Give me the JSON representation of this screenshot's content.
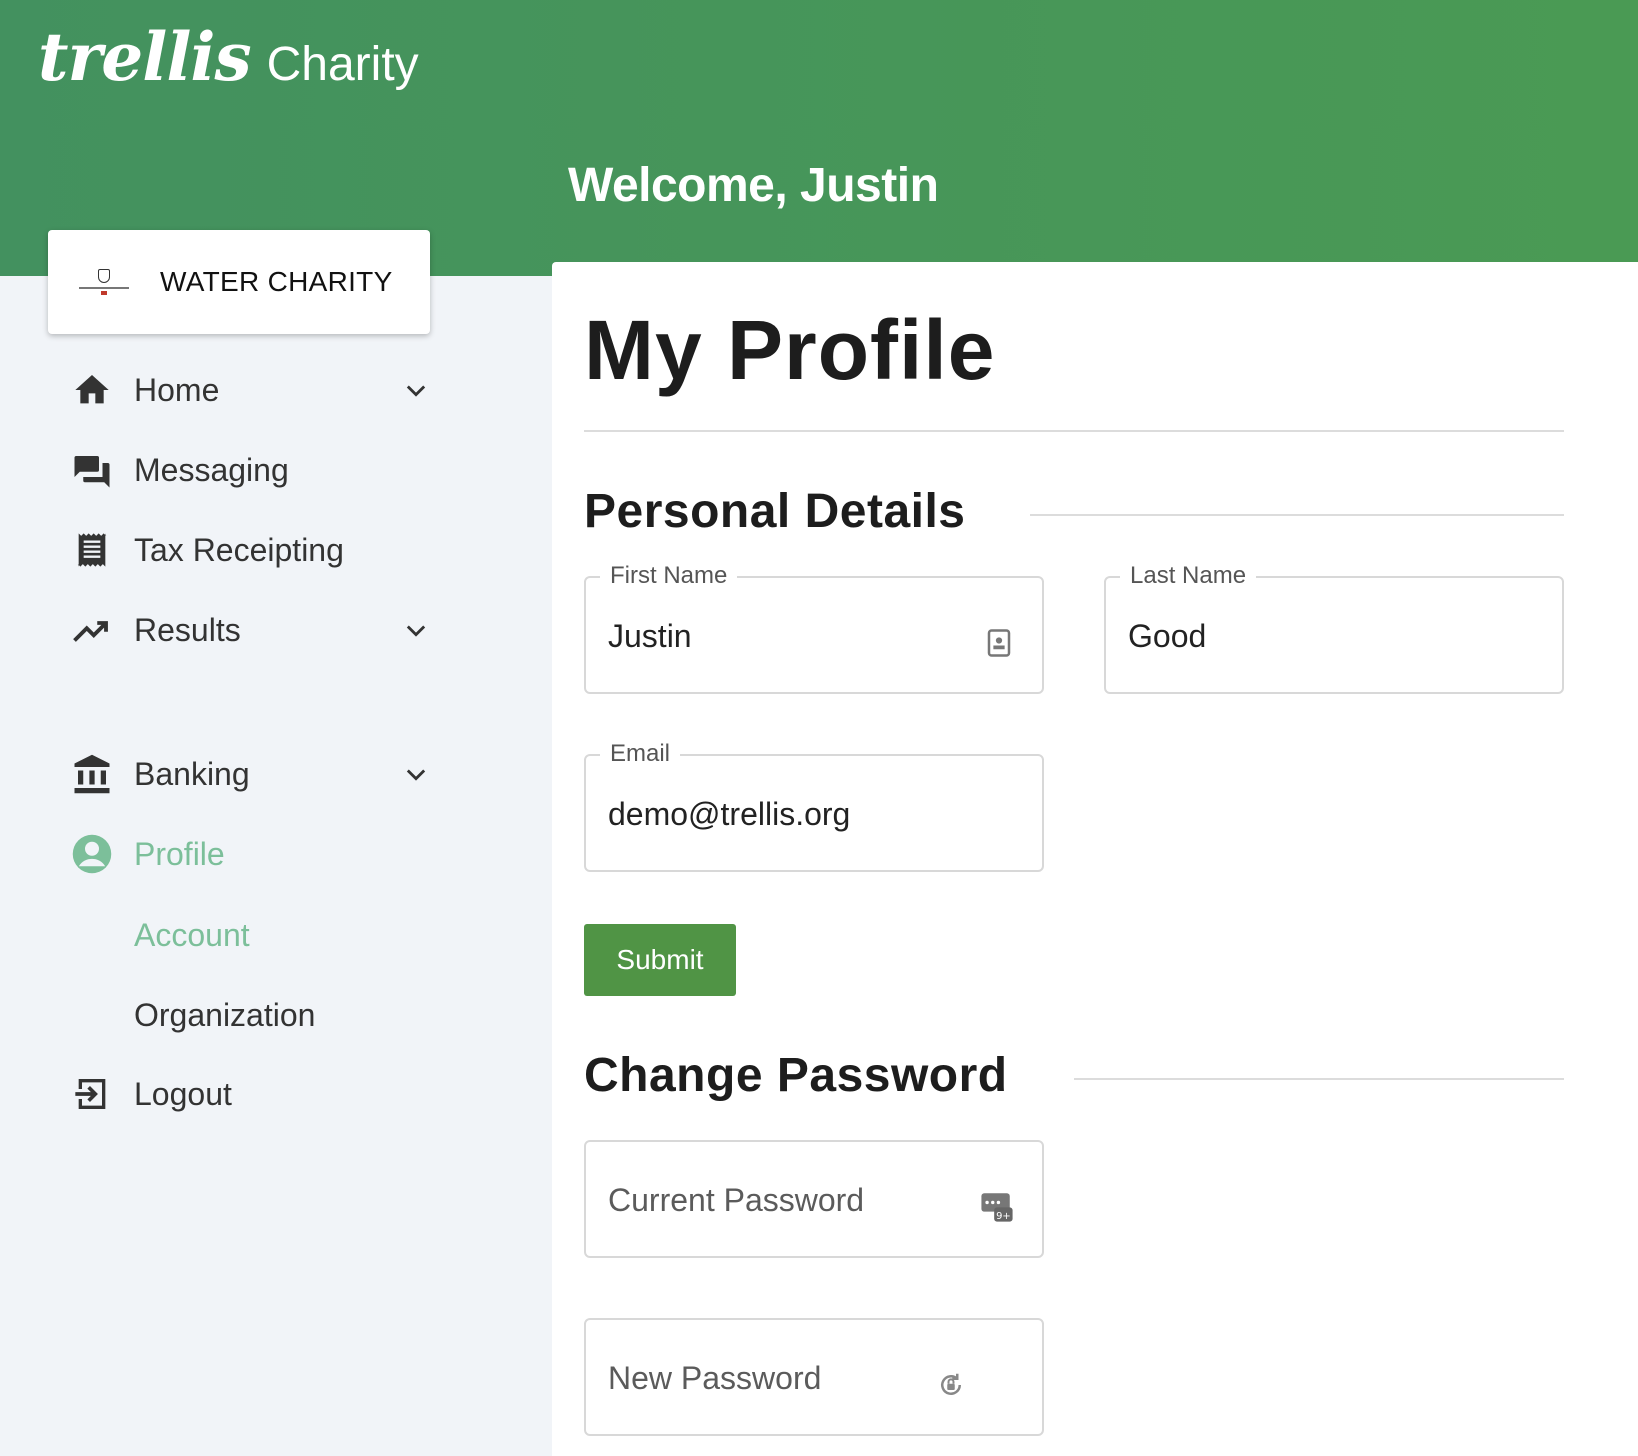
{
  "header": {
    "brand_logo": "trellis",
    "brand_sub": "Charity",
    "welcome": "Welcome, Justin",
    "bg_color": "#45955c"
  },
  "org": {
    "name": "WATER CHARITY"
  },
  "sidebar": {
    "items": [
      {
        "label": "Home",
        "icon": "home-icon",
        "has_chevron": true
      },
      {
        "label": "Messaging",
        "icon": "chat-icon",
        "has_chevron": false
      },
      {
        "label": "Tax Receipting",
        "icon": "receipt-icon",
        "has_chevron": false
      },
      {
        "label": "Results",
        "icon": "trending-up-icon",
        "has_chevron": true
      },
      {
        "label": "Banking",
        "icon": "bank-icon",
        "has_chevron": true
      },
      {
        "label": "Profile",
        "icon": "account-circle-icon",
        "active": true
      },
      {
        "label": "Logout",
        "icon": "logout-icon",
        "has_chevron": false
      }
    ],
    "profile_sub": [
      {
        "label": "Account",
        "active": true
      },
      {
        "label": "Organization",
        "active": false
      }
    ],
    "active_color": "#7cbf9a"
  },
  "main": {
    "title": "My Profile",
    "personal": {
      "heading": "Personal Details",
      "first_name": {
        "label": "First Name",
        "value": "Justin"
      },
      "last_name": {
        "label": "Last Name",
        "value": "Good"
      },
      "email": {
        "label": "Email",
        "value": "demo@trellis.org"
      },
      "submit_label": "Submit"
    },
    "password": {
      "heading": "Change Password",
      "current_placeholder": "Current Password",
      "new_placeholder": "New Password"
    },
    "accent_color": "#509445"
  }
}
